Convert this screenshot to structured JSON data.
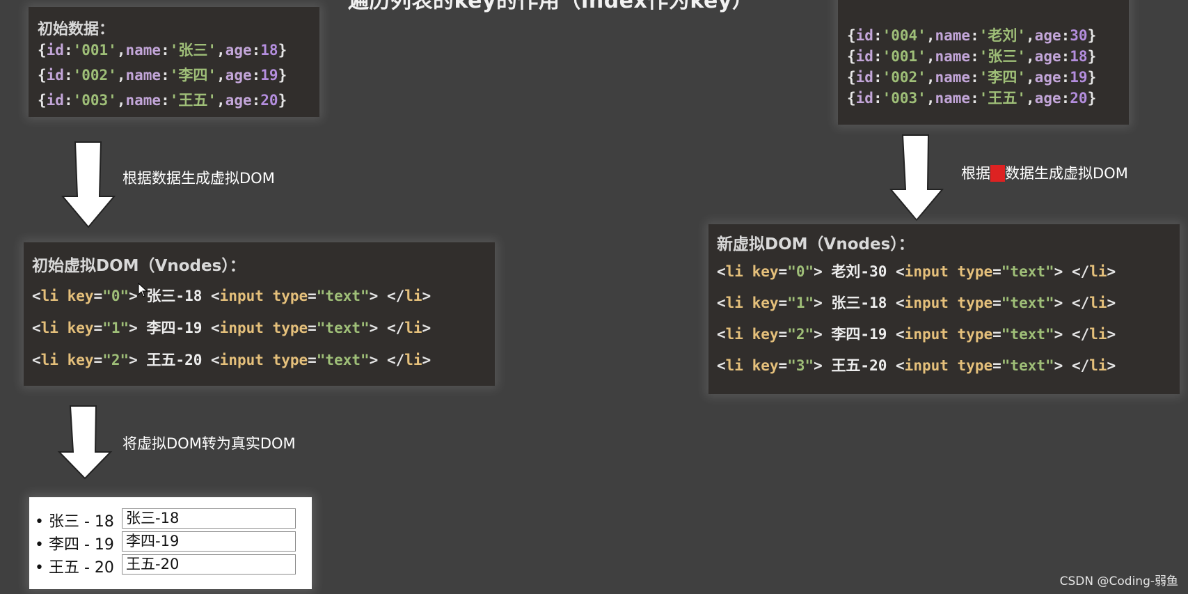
{
  "title": "遍历列表的key的作用（index作为key）",
  "initial_data": {
    "header": "初始数据：",
    "rows": [
      {
        "id": "001",
        "name": "张三",
        "age": "18"
      },
      {
        "id": "002",
        "name": "李四",
        "age": "19"
      },
      {
        "id": "003",
        "name": "王五",
        "age": "20"
      }
    ]
  },
  "new_data": {
    "rows": [
      {
        "id": "004",
        "name": "老刘",
        "age": "30"
      },
      {
        "id": "001",
        "name": "张三",
        "age": "18"
      },
      {
        "id": "002",
        "name": "李四",
        "age": "19"
      },
      {
        "id": "003",
        "name": "王五",
        "age": "20"
      }
    ]
  },
  "labels": {
    "gen_vdom": "根据数据生成虚拟DOM",
    "gen_new_prefix": "根据",
    "gen_new_highlight": "新",
    "gen_new_suffix": "数据生成虚拟DOM",
    "to_real": "将虚拟DOM转为真实DOM"
  },
  "initial_vdom": {
    "header": "初始虚拟DOM（Vnodes）：",
    "items": [
      {
        "key": "0",
        "text": "张三-18"
      },
      {
        "key": "1",
        "text": "李四-19"
      },
      {
        "key": "2",
        "text": "王五-20"
      }
    ]
  },
  "new_vdom": {
    "header": "新虚拟DOM（Vnodes）：",
    "items": [
      {
        "key": "0",
        "text": "老刘-30"
      },
      {
        "key": "1",
        "text": "张三-18"
      },
      {
        "key": "2",
        "text": "李四-19"
      },
      {
        "key": "3",
        "text": "王五-20"
      }
    ]
  },
  "code": {
    "li_open": "<li ",
    "key_attr": "key",
    "eq": "=",
    "input_open": "<input ",
    "type_attr": "type",
    "type_val": "\"text\"",
    "close_gt": ">",
    "li_close": "</li>",
    "id_kw": "id",
    "name_kw": "name",
    "age_kw": "age"
  },
  "real_dom": {
    "items": [
      {
        "label": "张三 - 18",
        "value": "张三-18"
      },
      {
        "label": "李四 - 19",
        "value": "李四-19"
      },
      {
        "label": "王五 - 20",
        "value": "王五-20"
      }
    ]
  },
  "watermark": "CSDN @Coding-弱鱼"
}
